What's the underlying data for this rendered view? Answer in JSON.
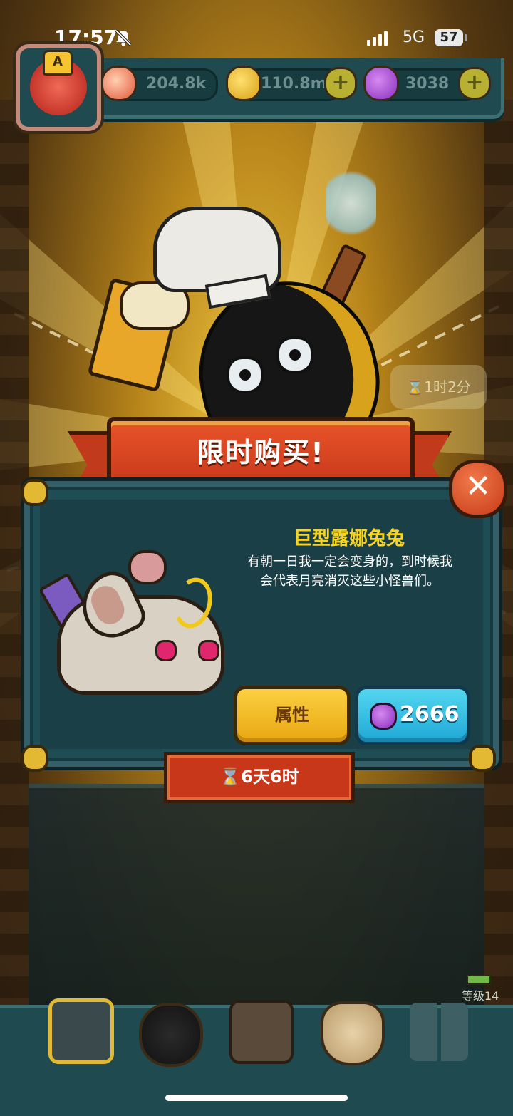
{
  "status_bar": {
    "time": "17:57",
    "network": "5G",
    "battery": "57",
    "icons": [
      "bell-muted-icon",
      "signal-bars-icon"
    ]
  },
  "currencies": {
    "eyes": "204.8k",
    "coins": "110.8m",
    "potions": "3038",
    "plus": "+"
  },
  "avatar": {
    "rank_letter": "A"
  },
  "background_timer": "⌛1时2分",
  "offer": {
    "banner_title": "限时购买!",
    "item_name": "巨型露娜兔兔",
    "item_desc_line1": "有朝一日我一定会变身的，到时候我",
    "item_desc_line2": "会代表月亮消灭这些小怪兽们。",
    "attributes_button": "属性",
    "price": "2666",
    "countdown": "⌛6天6时",
    "close_symbol": "✕"
  },
  "player_level": "等级14",
  "colors": {
    "panel_teal": "#1e4d55",
    "banner_red": "#c8381a",
    "name_yellow": "#f6d420",
    "button_yellow": "#fbd040",
    "button_blue": "#1fa8d6"
  }
}
